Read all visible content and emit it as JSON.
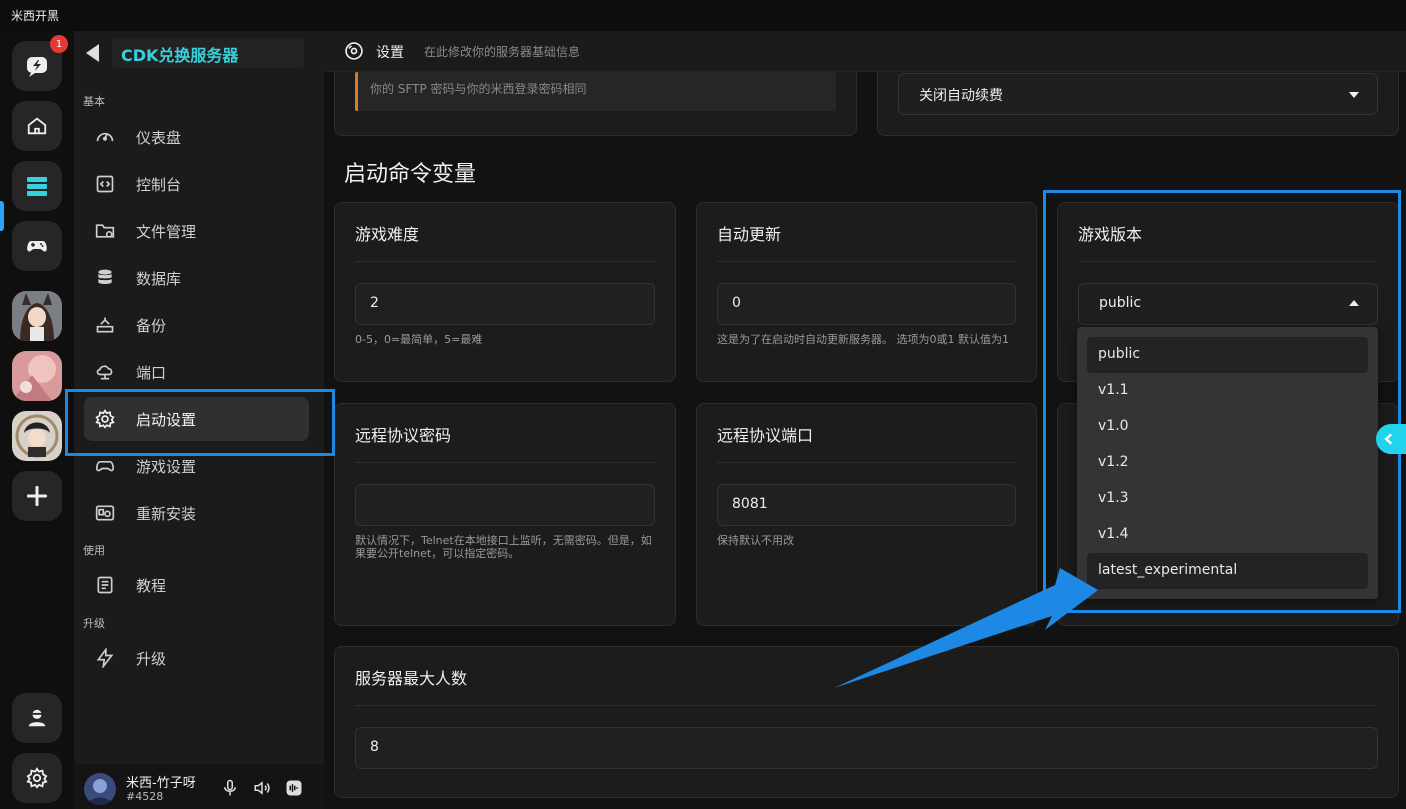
{
  "app": {
    "title": "米西开黑"
  },
  "rail": {
    "notification_count": "1"
  },
  "sidebar": {
    "server_name": "CDK兑换服务器",
    "sections": {
      "basic": "基本",
      "use": "使用",
      "upgrade": "升级"
    },
    "items": [
      {
        "label": "仪表盘",
        "icon": "gauge-icon"
      },
      {
        "label": "控制台",
        "icon": "code-icon"
      },
      {
        "label": "文件管理",
        "icon": "folder-icon"
      },
      {
        "label": "数据库",
        "icon": "database-icon"
      },
      {
        "label": "备份",
        "icon": "backup-icon"
      },
      {
        "label": "端口",
        "icon": "cloud-network-icon"
      },
      {
        "label": "启动设置",
        "icon": "gear-icon"
      },
      {
        "label": "游戏设置",
        "icon": "gamepad-icon"
      },
      {
        "label": "重新安装",
        "icon": "reinstall-icon"
      },
      {
        "label": "教程",
        "icon": "document-icon"
      },
      {
        "label": "升级",
        "icon": "lightning-icon"
      }
    ],
    "user": {
      "name": "米西-竹子呀",
      "id": "#4528"
    }
  },
  "header": {
    "title": "设置",
    "description": "在此修改你的服务器基础信息"
  },
  "top": {
    "notice": "你的 SFTP 密码与你的米西登录密码相同",
    "renew_select": "关闭自动续费"
  },
  "section_title": "启动命令变量",
  "cards": {
    "difficulty": {
      "title": "游戏难度",
      "value": "2",
      "hint": "0-5，0=最简单，5=最难"
    },
    "auto_update": {
      "title": "自动更新",
      "value": "0",
      "hint": "这是为了在启动时自动更新服务器。 选项为0或1 默认值为1"
    },
    "game_version": {
      "title": "游戏版本",
      "value": "public",
      "options": [
        "public",
        "v1.1",
        "v1.0",
        "v1.2",
        "v1.3",
        "v1.4",
        "latest_experimental"
      ]
    },
    "remote_password": {
      "title": "远程协议密码",
      "value": "",
      "hint": "默认情况下，Telnet在本地接口上监听，无需密码。但是，如果要公开telnet，可以指定密码。"
    },
    "remote_port": {
      "title": "远程协议端口",
      "value": "8081",
      "hint": "保持默认不用改"
    },
    "max_players": {
      "title": "服务器最大人数",
      "value": "8"
    }
  },
  "colors": {
    "accent": "#36d1dc",
    "highlight": "#1e88e5",
    "badge": "#e53935"
  }
}
